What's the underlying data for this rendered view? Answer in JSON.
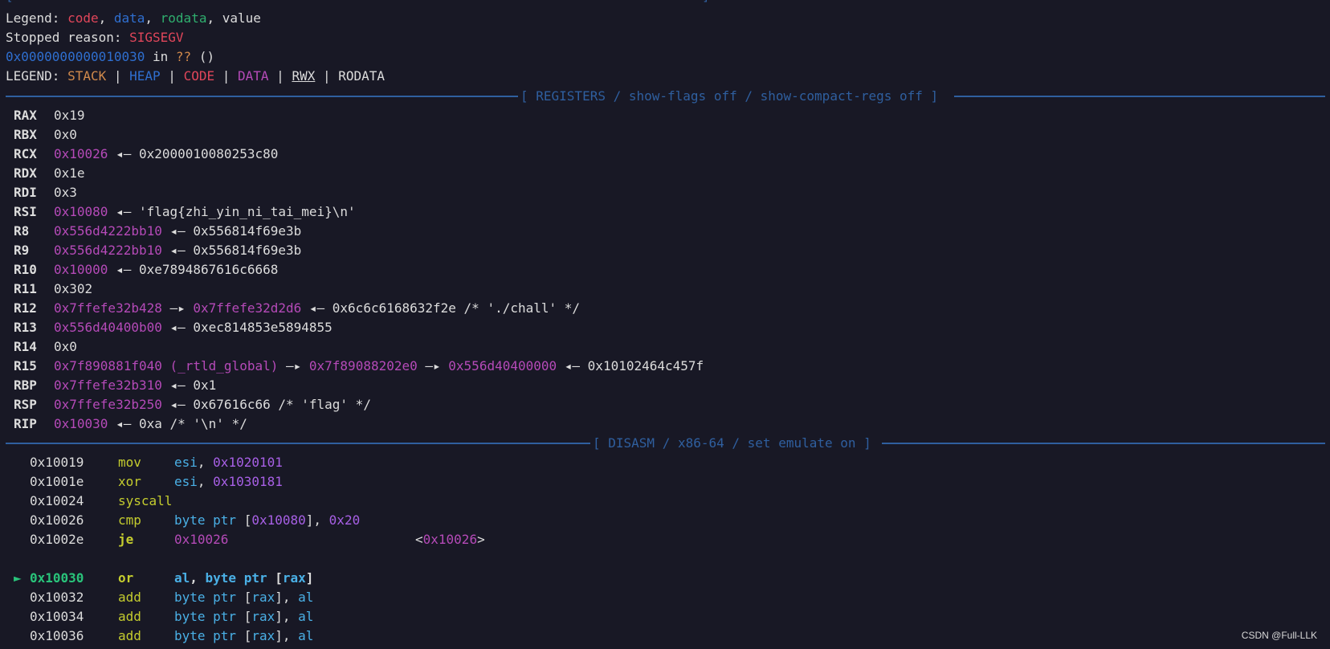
{
  "top_bracket": "[-----------------------------------------------------------------------------------------]",
  "legend_line": {
    "prefix": "Legend: ",
    "code": "code",
    "comma1": ", ",
    "data": "data",
    "comma2": ", ",
    "rodata": "rodata",
    "comma3": ", ",
    "value": "value"
  },
  "stop_line": {
    "prefix": "Stopped reason: ",
    "reason": "SIGSEGV"
  },
  "location_line": {
    "addr": "0x0000000000010030",
    "in": " in ",
    "func": "??",
    "parens": " ()"
  },
  "legend2": {
    "prefix": "LEGEND: ",
    "stack": "STACK",
    "sep1": " | ",
    "heap": "HEAP",
    "sep2": " | ",
    "code": "CODE",
    "sep3": " | ",
    "data": "DATA",
    "sep4": " | ",
    "rwx": "RWX",
    "sep5": " | ",
    "rodata": "RODATA"
  },
  "registers_header": "[ REGISTERS / show-flags off / show-compact-regs off ]",
  "registers": [
    {
      "name": "RAX",
      "parts": [
        {
          "t": "0x19",
          "c": "white"
        }
      ]
    },
    {
      "name": "RBX",
      "parts": [
        {
          "t": "0x0",
          "c": "white"
        }
      ]
    },
    {
      "name": "RCX",
      "parts": [
        {
          "t": "0x10026",
          "c": "purple"
        },
        {
          "t": " ◂— 0x2000010080253c80",
          "c": "white"
        }
      ]
    },
    {
      "name": "RDX",
      "parts": [
        {
          "t": "0x1e",
          "c": "white"
        }
      ]
    },
    {
      "name": "RDI",
      "parts": [
        {
          "t": "0x3",
          "c": "white"
        }
      ]
    },
    {
      "name": "RSI",
      "parts": [
        {
          "t": "0x10080",
          "c": "purple"
        },
        {
          "t": " ◂— 'flag{zhi_yin_ni_tai_mei}\\n'",
          "c": "white"
        }
      ]
    },
    {
      "name": "R8",
      "parts": [
        {
          "t": "0x556d4222bb10",
          "c": "purple"
        },
        {
          "t": " ◂— 0x556814f69e3b",
          "c": "white"
        }
      ]
    },
    {
      "name": "R9",
      "parts": [
        {
          "t": "0x556d4222bb10",
          "c": "purple"
        },
        {
          "t": " ◂— 0x556814f69e3b",
          "c": "white"
        }
      ]
    },
    {
      "name": "R10",
      "parts": [
        {
          "t": "0x10000",
          "c": "purple"
        },
        {
          "t": " ◂— 0xe7894867616c6668",
          "c": "white"
        }
      ]
    },
    {
      "name": "R11",
      "parts": [
        {
          "t": "0x302",
          "c": "white"
        }
      ]
    },
    {
      "name": "R12",
      "parts": [
        {
          "t": "0x7ffefe32b428",
          "c": "purple"
        },
        {
          "t": " —▸ ",
          "c": "white"
        },
        {
          "t": "0x7ffefe32d2d6",
          "c": "purple"
        },
        {
          "t": " ◂— 0x6c6c6168632f2e /* './chall' */",
          "c": "white"
        }
      ]
    },
    {
      "name": "R13",
      "parts": [
        {
          "t": "0x556d40400b00",
          "c": "purple"
        },
        {
          "t": " ◂— 0xec814853e5894855",
          "c": "white"
        }
      ]
    },
    {
      "name": "R14",
      "parts": [
        {
          "t": "0x0",
          "c": "white"
        }
      ]
    },
    {
      "name": "R15",
      "parts": [
        {
          "t": "0x7f890881f040 (_rtld_global)",
          "c": "purple"
        },
        {
          "t": " —▸ ",
          "c": "white"
        },
        {
          "t": "0x7f89088202e0",
          "c": "purple"
        },
        {
          "t": " —▸ ",
          "c": "white"
        },
        {
          "t": "0x556d40400000",
          "c": "purple"
        },
        {
          "t": " ◂— 0x10102464c457f",
          "c": "white"
        }
      ]
    },
    {
      "name": "RBP",
      "parts": [
        {
          "t": "0x7ffefe32b310",
          "c": "purple"
        },
        {
          "t": " ◂— 0x1",
          "c": "white"
        }
      ]
    },
    {
      "name": "RSP",
      "parts": [
        {
          "t": "0x7ffefe32b250",
          "c": "purple"
        },
        {
          "t": " ◂— 0x67616c66 /* 'flag' */",
          "c": "white"
        }
      ]
    },
    {
      "name": "RIP",
      "parts": [
        {
          "t": "0x10030",
          "c": "purple"
        },
        {
          "t": " ◂— 0xa /* '\\n' */",
          "c": "white"
        }
      ]
    }
  ],
  "disasm_header": "[ DISASM / x86-64 / set emulate on ]",
  "disasm": [
    {
      "addr": "0x10019",
      "mn": "mov",
      "ops": [
        {
          "t": "esi",
          "c": "cyan"
        },
        {
          "t": ", ",
          "c": "white"
        },
        {
          "t": "0x1020101",
          "c": "violet"
        }
      ],
      "target": null,
      "current": false
    },
    {
      "addr": "0x1001e",
      "mn": "xor",
      "ops": [
        {
          "t": "esi",
          "c": "cyan"
        },
        {
          "t": ", ",
          "c": "white"
        },
        {
          "t": "0x1030181",
          "c": "violet"
        }
      ],
      "target": null,
      "current": false
    },
    {
      "addr": "0x10024",
      "mn": "syscall",
      "ops": [],
      "target": null,
      "current": false
    },
    {
      "addr": "0x10026",
      "mn": "cmp",
      "ops": [
        {
          "t": "byte ptr",
          "c": "cyan"
        },
        {
          "t": " [",
          "c": "white"
        },
        {
          "t": "0x10080",
          "c": "violet"
        },
        {
          "t": "], ",
          "c": "white"
        },
        {
          "t": "0x20",
          "c": "violet"
        }
      ],
      "target": null,
      "current": false
    },
    {
      "addr": "0x1002e",
      "mn": "je",
      "mn_bold": true,
      "ops": [
        {
          "t": "0x10026",
          "c": "purple"
        }
      ],
      "target": [
        {
          "t": "<",
          "c": "white"
        },
        {
          "t": "0x10026",
          "c": "purple"
        },
        {
          "t": ">",
          "c": "white"
        }
      ],
      "current": false
    },
    {
      "blank": true
    },
    {
      "addr": "0x10030",
      "mn": "or",
      "ops": [
        {
          "t": "al",
          "c": "cyan"
        },
        {
          "t": ", ",
          "c": "white"
        },
        {
          "t": "byte ptr",
          "c": "cyan"
        },
        {
          "t": " [",
          "c": "white"
        },
        {
          "t": "rax",
          "c": "cyan"
        },
        {
          "t": "]",
          "c": "white"
        }
      ],
      "target": null,
      "current": true,
      "marker": "►"
    },
    {
      "addr": "0x10032",
      "mn": "add",
      "ops": [
        {
          "t": "byte ptr",
          "c": "cyan"
        },
        {
          "t": " [",
          "c": "white"
        },
        {
          "t": "rax",
          "c": "cyan"
        },
        {
          "t": "], ",
          "c": "white"
        },
        {
          "t": "al",
          "c": "cyan"
        }
      ],
      "target": null,
      "current": false
    },
    {
      "addr": "0x10034",
      "mn": "add",
      "ops": [
        {
          "t": "byte ptr",
          "c": "cyan"
        },
        {
          "t": " [",
          "c": "white"
        },
        {
          "t": "rax",
          "c": "cyan"
        },
        {
          "t": "], ",
          "c": "white"
        },
        {
          "t": "al",
          "c": "cyan"
        }
      ],
      "target": null,
      "current": false
    },
    {
      "addr": "0x10036",
      "mn": "add",
      "ops": [
        {
          "t": "byte ptr",
          "c": "cyan"
        },
        {
          "t": " [",
          "c": "white"
        },
        {
          "t": "rax",
          "c": "cyan"
        },
        {
          "t": "], ",
          "c": "white"
        },
        {
          "t": "al",
          "c": "cyan"
        }
      ],
      "target": null,
      "current": false
    }
  ],
  "watermark": "CSDN @Full-LLK",
  "colors": {
    "background": "#181825",
    "separator": "#2f5f9f",
    "code": "#e0465a",
    "data": "#2f6fd0",
    "rodata": "#2fae6e",
    "stack": "#d18a4c",
    "pointer": "#b54ab8",
    "mnemonic": "#c4cc2e",
    "immediate": "#a860e6",
    "register": "#4ab0e6",
    "current": "#29c37a"
  }
}
